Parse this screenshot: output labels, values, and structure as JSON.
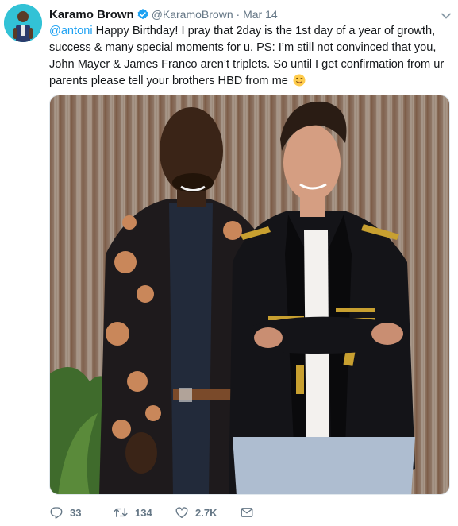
{
  "tweet": {
    "author_name": "Karamo Brown",
    "handle": "@KaramoBrown",
    "separator": "·",
    "date": "Mar 14",
    "mention": "@antoni",
    "body": " Happy Birthday! I pray that 2day is the 1st day of a year of growth, success & many special moments for u. PS: I’m still not convinced that you, John Mayer & James Franco aren’t triplets. So until I get confirmation from ur parents please tell your brothers HBD from me",
    "emoji": "winking-face-with-tongue"
  },
  "actions": {
    "replies": "33",
    "retweets": "134",
    "likes": "2.7K"
  },
  "icons": {
    "verified": "verified-badge-icon",
    "caret": "chevron-down-icon",
    "reply": "reply-icon",
    "retweet": "retweet-icon",
    "like": "heart-icon",
    "dm": "envelope-icon"
  },
  "colors": {
    "accent": "#1da1f2",
    "text": "#14171a",
    "muted": "#657786",
    "avatar_bg": "#32c2d6"
  }
}
